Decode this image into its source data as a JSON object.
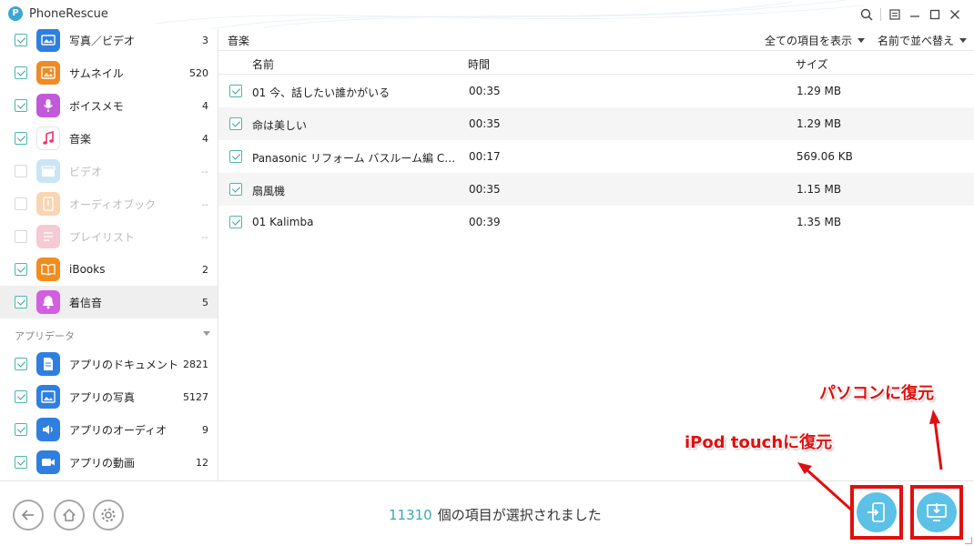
{
  "window": {
    "app_title": "PhoneRescue",
    "logo_letter": "P"
  },
  "sidebar": {
    "items": [
      {
        "label": "写真／ビデオ",
        "count": "3",
        "checked": true,
        "enabled": true,
        "icon": "photo-icon",
        "color": "#2f7fe0"
      },
      {
        "label": "サムネイル",
        "count": "520",
        "checked": true,
        "enabled": true,
        "icon": "thumbnail-icon",
        "color": "#f08a24"
      },
      {
        "label": "ボイスメモ",
        "count": "4",
        "checked": true,
        "enabled": true,
        "icon": "microphone-icon",
        "color": "#c05ad8"
      },
      {
        "label": "音楽",
        "count": "4",
        "checked": true,
        "enabled": true,
        "icon": "music-note-icon",
        "color": "#ffffff"
      },
      {
        "label": "ビデオ",
        "count": "--",
        "checked": false,
        "enabled": false,
        "icon": "clapperboard-icon",
        "color": "#9ad0ee"
      },
      {
        "label": "オーディオブック",
        "count": "--",
        "checked": false,
        "enabled": false,
        "icon": "audiobook-icon",
        "color": "#f3b27a"
      },
      {
        "label": "プレイリスト",
        "count": "--",
        "checked": false,
        "enabled": false,
        "icon": "playlist-icon",
        "color": "#f0a0b0"
      },
      {
        "label": "iBooks",
        "count": "2",
        "checked": true,
        "enabled": true,
        "icon": "book-icon",
        "color": "#f28c1e"
      },
      {
        "label": "着信音",
        "count": "5",
        "checked": true,
        "enabled": true,
        "icon": "bell-icon",
        "color": "#d25ee0",
        "active": true
      }
    ],
    "section_label": "アプリデータ",
    "app_items": [
      {
        "label": "アプリのドキュメント",
        "count": "2821",
        "checked": true,
        "icon": "document-icon",
        "color": "#2f7fe0"
      },
      {
        "label": "アプリの写真",
        "count": "5127",
        "checked": true,
        "icon": "image-icon",
        "color": "#2f7fe0"
      },
      {
        "label": "アプリのオーディオ",
        "count": "9",
        "checked": true,
        "icon": "speaker-icon",
        "color": "#2f7fe0"
      },
      {
        "label": "アプリの動画",
        "count": "12",
        "checked": true,
        "icon": "video-camera-icon",
        "color": "#2f7fe0"
      }
    ]
  },
  "main": {
    "title": "音楽",
    "show_filter": "全ての項目を表示",
    "sort_filter": "名前で並べ替え",
    "columns": {
      "name": "名前",
      "time": "時間",
      "size": "サイズ"
    },
    "rows": [
      {
        "name": "01 今、話したい誰かがいる",
        "time": "00:35",
        "size": "1.29 MB"
      },
      {
        "name": "命は美しい",
        "time": "00:35",
        "size": "1.29 MB"
      },
      {
        "name": "Panasonic リフォーム バスルーム編 CMメイキ...",
        "time": "00:17",
        "size": "569.06 KB"
      },
      {
        "name": "扇風機",
        "time": "00:35",
        "size": "1.15 MB"
      },
      {
        "name": "01 Kalimba",
        "time": "00:39",
        "size": "1.35 MB"
      }
    ]
  },
  "footer": {
    "selected_count": "11310",
    "selected_text": "個の項目が選択されました"
  },
  "annotations": {
    "to_device": "iPod touchに復元",
    "to_computer": "パソコンに復元"
  },
  "colors": {
    "accent": "#35a594",
    "highlight": "#e01010",
    "action_button": "#5cc1e6"
  }
}
